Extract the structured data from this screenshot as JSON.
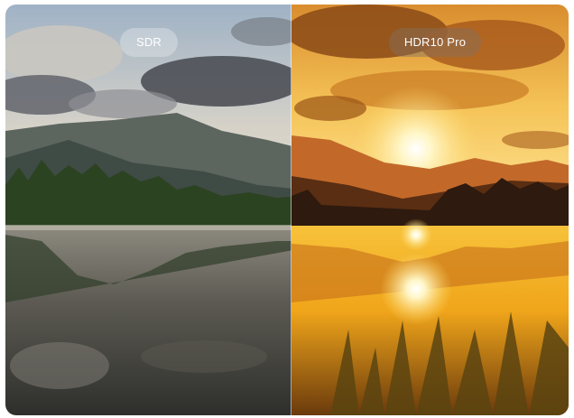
{
  "labels": {
    "sdr": "SDR",
    "hdr": "HDR10 Pro"
  },
  "scene": {
    "description_icon": "mountain-lake-sunset",
    "sdr_palette": {
      "sky_top": "#aab8c8",
      "sky_bottom": "#d8d0c2",
      "mountain": "#4f5a55",
      "trees": "#2e4a24",
      "water": "#6e6a60",
      "cloud": "#3c3f45"
    },
    "hdr_palette": {
      "sky_top": "#e09a3a",
      "sky_bottom": "#ffe080",
      "sun": "#fffbe6",
      "mountain": "#b05a20",
      "trees": "#3a2414",
      "water": "#f2b018",
      "cloud": "#7a3f12"
    }
  }
}
